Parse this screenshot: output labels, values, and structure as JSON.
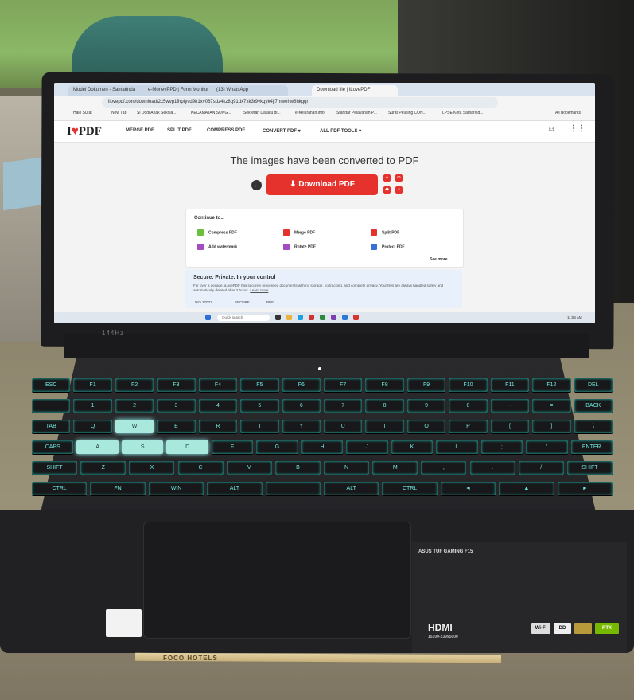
{
  "browser": {
    "tabs": [
      "Model Dokumen - Samarinda",
      "e-MonevPPD | Form Monitor",
      "(13) WhatsApp",
      "Download file | iLovePDF"
    ],
    "active_tab_index": 3,
    "url": "ilovepdf.com/download/2c5wvp1fhpfyvd9h1xv067sdz4kz8q91dx7xk3r9vkqyk4jj7mwehw8hkgqr",
    "bookmarks": [
      "Halo Surat",
      "New Tab",
      "Si Dodi Anak Sekola...",
      "KECAMATAN SUNG...",
      "Sekretari Dataku di...",
      "e-Kelurahan.info",
      "Standar Pelayanan P...",
      "Surat Pelaling CON...",
      "LPSE Kota Samarind..."
    ],
    "all_bookmarks": "All Bookmarks"
  },
  "site": {
    "logo_prefix": "I",
    "logo_suffix": "PDF",
    "nav": [
      "MERGE PDF",
      "SPLIT PDF",
      "COMPRESS PDF",
      "CONVERT PDF ▾",
      "ALL PDF TOOLS ▾"
    ],
    "heading": "The images have been converted to PDF",
    "download_label": "Download PDF",
    "continue_title": "Continue to...",
    "actions": [
      {
        "label": "Compress PDF",
        "color": "#6bbf3a"
      },
      {
        "label": "Merge PDF",
        "color": "#e5322d"
      },
      {
        "label": "Split PDF",
        "color": "#e5322d"
      },
      {
        "label": "Add watermark",
        "color": "#a54bc4"
      },
      {
        "label": "Rotate PDF",
        "color": "#a54bc4"
      },
      {
        "label": "Protect PDF",
        "color": "#3b6fd8"
      }
    ],
    "see_more": "See more",
    "secure_title": "Secure. Private. In your control",
    "secure_text": "For over a decade, iLovePDF has securely processed documents with no storage, no tracking, and complete privacy. Your files are always handled safely and automatically deleted after 2 hours.",
    "learn_more": "Learn more",
    "certs": [
      "ISO 27001",
      "SECURE",
      "PDF"
    ]
  },
  "taskbar": {
    "search": "Quick search",
    "time": "11:54 AM"
  },
  "laptop": {
    "screen_label": "144Hz",
    "brand_text": "ASUS TUF GAMING F15",
    "hdmi": "HDMI",
    "serial": "15100-23995000",
    "pencil_text": "FOCO HOTELS"
  },
  "keyboard_rows": [
    [
      "ESC",
      "F1",
      "F2",
      "F3",
      "F4",
      "F5",
      "F6",
      "F7",
      "F8",
      "F9",
      "F10",
      "F11",
      "F12",
      "DEL"
    ],
    [
      "~",
      "1",
      "2",
      "3",
      "4",
      "5",
      "6",
      "7",
      "8",
      "9",
      "0",
      "-",
      "=",
      "BACK"
    ],
    [
      "TAB",
      "Q",
      "W",
      "E",
      "R",
      "T",
      "Y",
      "U",
      "I",
      "O",
      "P",
      "[",
      "]",
      "\\"
    ],
    [
      "CAPS",
      "A",
      "S",
      "D",
      "F",
      "G",
      "H",
      "J",
      "K",
      "L",
      ";",
      "'",
      "ENTER"
    ],
    [
      "SHIFT",
      "Z",
      "X",
      "C",
      "V",
      "B",
      "N",
      "M",
      ",",
      ".",
      "/",
      "SHIFT"
    ],
    [
      "CTRL",
      "FN",
      "WIN",
      "ALT",
      "",
      "ALT",
      "CTRL",
      "◄",
      "▲",
      "►"
    ]
  ],
  "lit_keys": [
    "W",
    "A",
    "S",
    "D"
  ],
  "colors": {
    "brand_red": "#e5322d",
    "key_glow": "#2ad6c8"
  }
}
